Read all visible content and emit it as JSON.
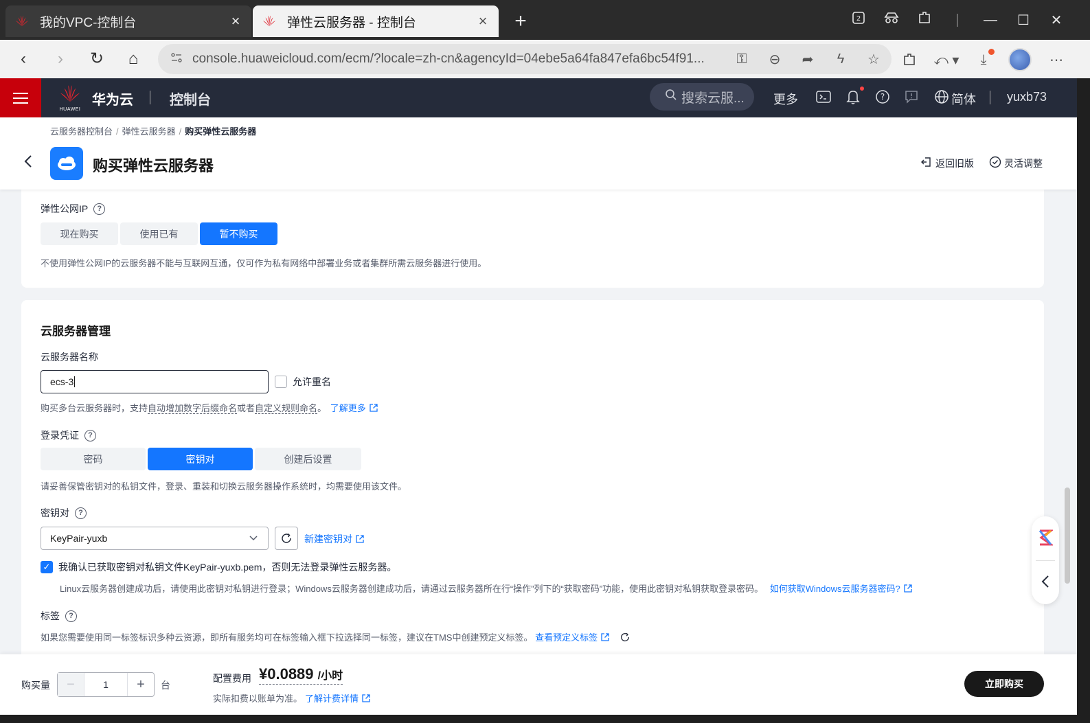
{
  "browser": {
    "tabs": [
      {
        "title": "我的VPC-控制台",
        "active": false
      },
      {
        "title": "弹性云服务器 - 控制台",
        "active": true
      }
    ],
    "url": "console.huaweicloud.com/ecm/?locale=zh-cn&agencyId=04ebe5a64fa847efa6bc54f91..."
  },
  "header": {
    "logo_text": "HUAWEI",
    "brand": "华为云",
    "console": "控制台",
    "search_placeholder": "搜索云服...",
    "more": "更多",
    "language": "简体",
    "user": "yuxb73"
  },
  "page": {
    "breadcrumb": [
      "云服务器控制台",
      "弹性云服务器",
      "购买弹性云服务器"
    ],
    "title": "购买弹性云服务器",
    "return_old": "返回旧版",
    "flexible": "灵活调整"
  },
  "eip": {
    "label": "弹性公网IP",
    "options": [
      "现在购买",
      "使用已有",
      "暂不购买"
    ],
    "selected_index": 2,
    "hint": "不使用弹性公网IP的云服务器不能与互联网互通，仅可作为私有网络中部署业务或者集群所需云服务器进行使用。"
  },
  "management": {
    "section_title": "云服务器管理",
    "name_label": "云服务器名称",
    "name_value": "ecs-3",
    "allow_dup": "允许重名",
    "name_hint_pre": "购买多台云服务器时，支持",
    "name_hint_auto": "自动增加数字后缀命名",
    "name_hint_mid": "或者",
    "name_hint_custom": "自定义规则命名",
    "name_hint_end": "。",
    "learn_more": "了解更多",
    "cred_label": "登录凭证",
    "cred_options": [
      "密码",
      "密钥对",
      "创建后设置"
    ],
    "cred_selected_index": 1,
    "cred_hint": "请妥善保管密钥对的私钥文件，登录、重装和切换云服务器操作系统时，均需要使用该文件。",
    "keypair_label": "密钥对",
    "keypair_value": "KeyPair-yuxb",
    "new_keypair": "新建密钥对",
    "confirm_text": "我确认已获取密钥对私钥文件KeyPair-yuxb.pem，否则无法登录弹性云服务器。",
    "confirm_checked": true,
    "os_hint": "Linux云服务器创建成功后，请使用此密钥对私钥进行登录；Windows云服务器创建成功后，请通过云服务器所在行“操作”列下的“获取密码”功能，使用此密钥对私钥获取登录密码。",
    "win_link": "如何获取Windows云服务器密码?",
    "tag_label": "标签",
    "tag_hint": "如果您需要使用同一标签标识多种云资源，即所有服务均可在标签输入框下拉选择同一标签，建议在TMS中创建预定义标签。",
    "tag_link": "查看预定义标签"
  },
  "footer": {
    "qty_label": "购买量",
    "qty_value": "1",
    "qty_unit": "台",
    "fee_label": "配置费用",
    "price": "¥0.0889",
    "price_unit": "/小时",
    "fee_note": "实际扣费以账单为准。",
    "fee_link": "了解计费详情",
    "buy": "立即购买"
  },
  "colors": {
    "accent": "#1476ff",
    "header_bg": "#252b3a",
    "brand_red": "#c7000b"
  }
}
